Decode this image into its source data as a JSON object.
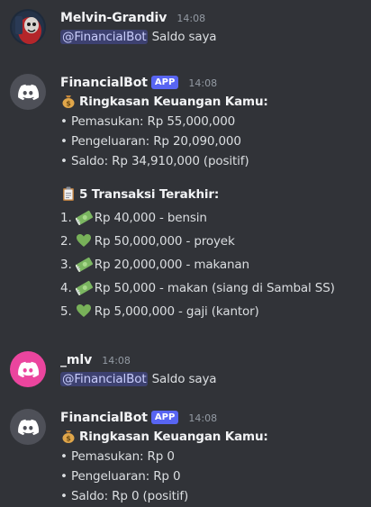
{
  "messages": [
    {
      "username": "Melvin-Grandiv",
      "timestamp": "14:08",
      "mention": "@FinancialBot",
      "text": " Saldo saya"
    },
    {
      "username": "FinancialBot",
      "app_tag": "APP",
      "timestamp": "14:08",
      "summary_title": "Ringkasan Keuangan Kamu:",
      "summary_lines": [
        "• Pemasukan: Rp 55,000,000",
        "• Pengeluaran: Rp 20,090,000",
        "• Saldo: Rp 34,910,000 (positif)"
      ],
      "transactions_title": "5 Transaksi Terakhir:",
      "transactions": [
        {
          "index": "1.",
          "icon": "money-flying-icon",
          "text": "Rp 40,000 - bensin"
        },
        {
          "index": "2.",
          "icon": "green-heart-icon",
          "text": "Rp 50,000,000 - proyek"
        },
        {
          "index": "3.",
          "icon": "money-flying-icon",
          "text": "Rp 20,000,000 - makanan"
        },
        {
          "index": "4.",
          "icon": "money-flying-icon",
          "text": "Rp 50,000 - makan (siang di Sambal SS)"
        },
        {
          "index": "5.",
          "icon": "green-heart-icon",
          "text": "Rp 5,000,000 - gaji (kantor)"
        }
      ]
    },
    {
      "username": "_mlv",
      "timestamp": "14:08",
      "mention": "@FinancialBot",
      "text": " Saldo saya"
    },
    {
      "username": "FinancialBot",
      "app_tag": "APP",
      "timestamp": "14:08",
      "summary_title": "Ringkasan Keuangan Kamu:",
      "summary_lines": [
        "• Pemasukan: Rp 0",
        "• Pengeluaran: Rp 0",
        "• Saldo: Rp 0 (positif)"
      ]
    }
  ],
  "colors": {
    "background": "#313338",
    "app_tag": "#5865f2",
    "bot_avatar": "#4e5058",
    "mlv_avatar": "#eb459e",
    "mention_bg": "rgba(88,101,242,0.3)"
  }
}
